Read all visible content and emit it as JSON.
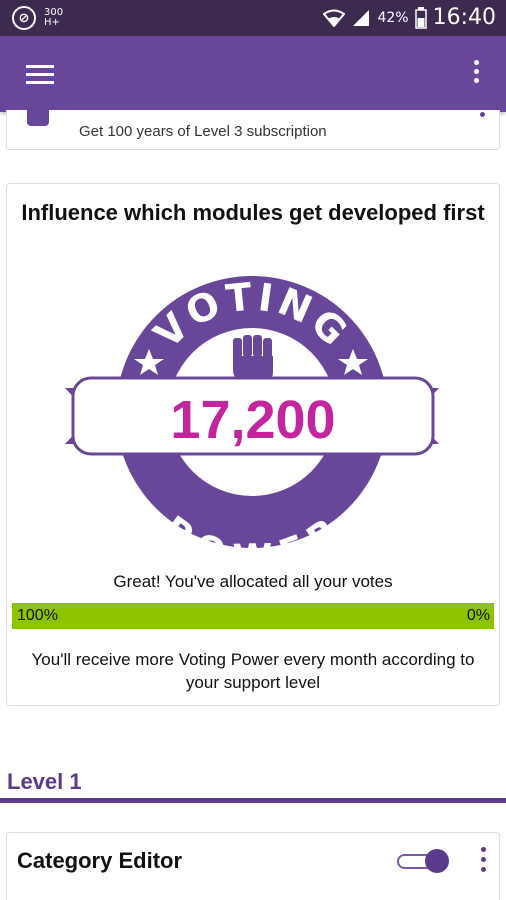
{
  "status_bar": {
    "app_icon": "data-saver-icon",
    "network_top": "300",
    "network_bottom": "H+",
    "battery_percent": "42%",
    "time": "16:40"
  },
  "app_bar": {
    "menu_icon": "hamburger-menu-icon",
    "overflow_icon": "more-vert-icon",
    "color": "#68479b"
  },
  "top_card": {
    "text": "Get 100 years of Level 3 subscription"
  },
  "voting_card": {
    "heading": "Influence which modules get developed first",
    "badge": {
      "top_text": "VOTING",
      "bottom_text": "POWER",
      "value": "17,200",
      "icon": "raised-fist-icon",
      "star_icon": "star-icon",
      "color": "#68479b",
      "value_color": "#c2259e"
    },
    "allocated_text": "Great! You've allocated all your votes",
    "progress": {
      "fraction": 1.0,
      "left_label": "100%",
      "right_label": "0%",
      "color": "#8dc400"
    },
    "note": "You'll receive more Voting Power every month according to your support level"
  },
  "section": {
    "title": "Level 1"
  },
  "module_card": {
    "title": "Category Editor",
    "toggle_on": true
  }
}
